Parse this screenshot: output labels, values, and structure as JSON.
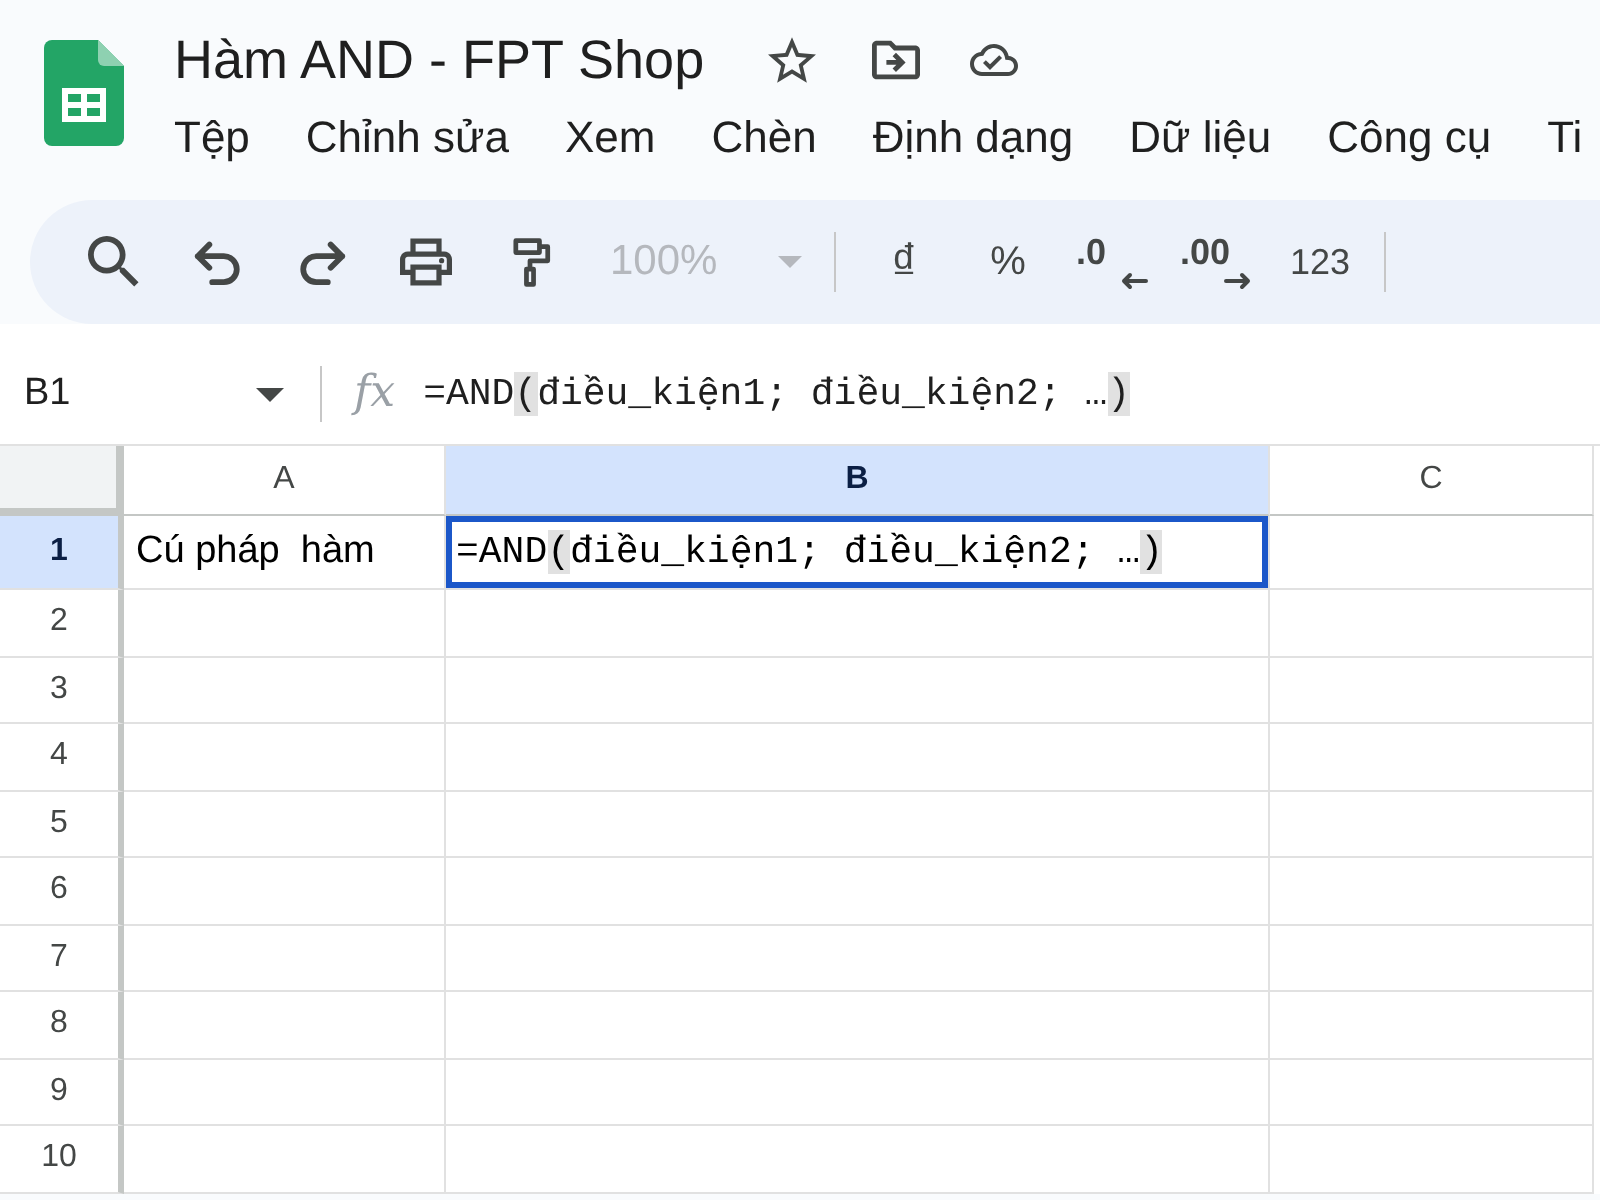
{
  "document": {
    "title": "Hàm AND - FPT Shop"
  },
  "menu": [
    "Tệp",
    "Chỉnh sửa",
    "Xem",
    "Chèn",
    "Định dạng",
    "Dữ liệu",
    "Công cụ",
    "Ti"
  ],
  "toolbar": {
    "zoom": {
      "value": "100%",
      "disabled": true
    },
    "currency": "₫",
    "percent": "%",
    "decrease_decimals": ".0",
    "increase_decimals": ".00",
    "number_format": "123"
  },
  "formula_bar": {
    "name_box": "B1",
    "fx": "fx",
    "formula": [
      {
        "text": "=AND",
        "highlighted": false
      },
      {
        "text": "(",
        "highlighted": true
      },
      {
        "text": "điều_kiện1; điều_kiện2; …",
        "highlighted": false
      },
      {
        "text": ")",
        "highlighted": true
      }
    ]
  },
  "grid": {
    "columns": [
      {
        "label": "A",
        "selected": false
      },
      {
        "label": "B",
        "selected": true
      },
      {
        "label": "C",
        "selected": false
      }
    ],
    "rows": [
      {
        "label": "1",
        "selected": true,
        "cells": [
          {
            "text": "Cú pháp  hàm",
            "active": false
          },
          {
            "formula": [
              {
                "text": "=AND",
                "highlighted": false
              },
              {
                "text": "(",
                "highlighted": true
              },
              {
                "text": "điều_kiện1; điều_kiện2; …",
                "highlighted": false
              },
              {
                "text": ")",
                "highlighted": true
              }
            ],
            "active": true
          },
          {
            "active": false
          }
        ]
      },
      {
        "label": "2",
        "selected": false
      },
      {
        "label": "3",
        "selected": false
      },
      {
        "label": "4",
        "selected": false
      },
      {
        "label": "5",
        "selected": false
      },
      {
        "label": "6",
        "selected": false
      },
      {
        "label": "7",
        "selected": false
      },
      {
        "label": "8",
        "selected": false
      },
      {
        "label": "9",
        "selected": false
      },
      {
        "label": "10",
        "selected": false
      }
    ]
  }
}
